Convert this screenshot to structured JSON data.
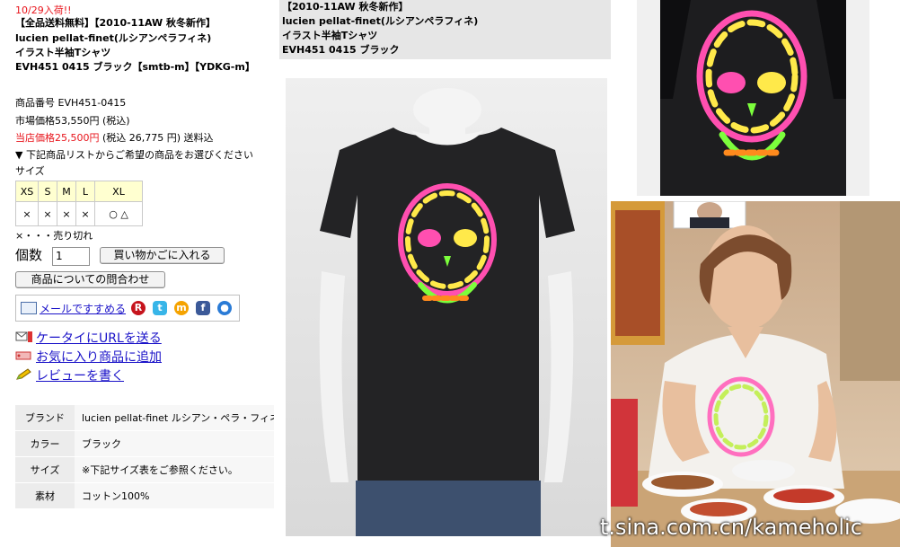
{
  "left": {
    "arrival": "10/29入荷!!",
    "title_lines": [
      "【全品送料無料】【2010-11AW 秋冬新作】",
      "lucien pellat-finet(ルシアンペラフィネ)",
      "イラスト半袖Tシャツ",
      "EVH451 0415 ブラック【smtb-m】【YDKG-m】"
    ],
    "product_no": "商品番号  EVH451-0415",
    "market_price": "市場価格53,550円 (税込)",
    "store_price": "当店価格25,500円",
    "store_price_tail": "(税込 26,775 円) 送料込",
    "select_prompt": "▼ 下記商品リストからご希望の商品をお選びください",
    "size_label": "サイズ",
    "sizes": [
      "XS",
      "S",
      "M",
      "L",
      "XL"
    ],
    "stock": [
      "×",
      "×",
      "×",
      "×",
      "○ △"
    ],
    "sold_out_note": "×・・・売り切れ",
    "qty_label": "個数",
    "qty_value": "1",
    "cart_button": "買い物かごに入れる",
    "inquiry_button": "商品についての問合わせ",
    "mail_recommend": "メールですすめる",
    "links": [
      "ケータイにURLを送る",
      "お気に入り商品に追加",
      "レビューを書く"
    ],
    "spec": [
      {
        "k": "ブランド",
        "v": "lucien pellat-finet ルシアン・ペラ・フィネ"
      },
      {
        "k": "カラー",
        "v": "ブラック"
      },
      {
        "k": "サイズ",
        "v": "※下記サイズ表をご参照ください。"
      },
      {
        "k": "素材",
        "v": "コットン100%"
      }
    ]
  },
  "caption": {
    "lines": [
      "【2010-11AW 秋冬新作】",
      "lucien pellat-finet(ルシアンペラフィネ)",
      "イラスト半袖Tシャツ",
      "EVH451 0415 ブラック"
    ]
  },
  "watermark": "t.sina.com.cn/kameholic",
  "colors": {
    "price_red": "#e8141b",
    "link_blue": "#1a12c8",
    "size_header": "#ffffd0",
    "caption_bg": "#e6e6e6"
  }
}
